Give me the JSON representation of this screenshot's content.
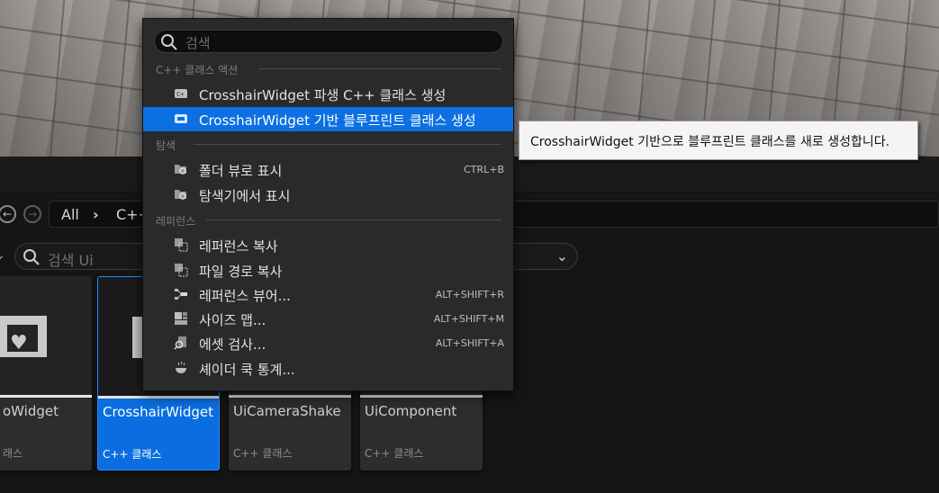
{
  "navbar": {
    "back": "←",
    "forward": "→",
    "crumbs": [
      "All",
      "C++"
    ],
    "sep": "›"
  },
  "filter": {
    "placeholder": "검색 Ui",
    "chevron": "⌄"
  },
  "tiles": [
    {
      "name": "oWidget",
      "type": "래스",
      "selected": false
    },
    {
      "name": "CrosshairWidget",
      "type": "C++ 클래스",
      "selected": true
    },
    {
      "name": "UiCameraShake",
      "type": "C++ 클래스",
      "selected": false
    },
    {
      "name": "UiComponent",
      "type": "C++ 클래스",
      "selected": false
    }
  ],
  "menu": {
    "search_placeholder": "검색",
    "sections": {
      "cpp_actions": "C++ 클래스 액션",
      "explore": "탐색",
      "references": "레퍼런스"
    },
    "items": [
      {
        "label": "CrosshairWidget 파생 C++ 클래스 생성",
        "shortcut": "",
        "icon": "cpp-class-icon"
      },
      {
        "label": "CrosshairWidget 기반 블루프린트 클래스 생성",
        "shortcut": "",
        "icon": "blueprint-class-icon"
      },
      {
        "label": "폴더 뷰로 표시",
        "shortcut": "CTRL+B",
        "icon": "folder-search-icon"
      },
      {
        "label": "탐색기에서 표시",
        "shortcut": "",
        "icon": "folder-search-icon"
      },
      {
        "label": "레퍼런스 복사",
        "shortcut": "",
        "icon": "copy-reference-icon"
      },
      {
        "label": "파일 경로 복사",
        "shortcut": "",
        "icon": "copy-path-icon"
      },
      {
        "label": "레퍼런스 뷰어...",
        "shortcut": "ALT+SHIFT+R",
        "icon": "reference-viewer-icon"
      },
      {
        "label": "사이즈 맵...",
        "shortcut": "ALT+SHIFT+M",
        "icon": "size-map-icon"
      },
      {
        "label": "에셋 검사...",
        "shortcut": "ALT+SHIFT+A",
        "icon": "audit-icon"
      },
      {
        "label": "셰이더 쿡 통계...",
        "shortcut": "",
        "icon": "shader-stats-icon"
      }
    ]
  },
  "tooltip": "CrosshairWidget 기반으로 블루프린트 클래스를 새로 생성합니다.",
  "colors": {
    "highlight": "#0c70e2",
    "menu_bg": "#2a2a2a"
  }
}
